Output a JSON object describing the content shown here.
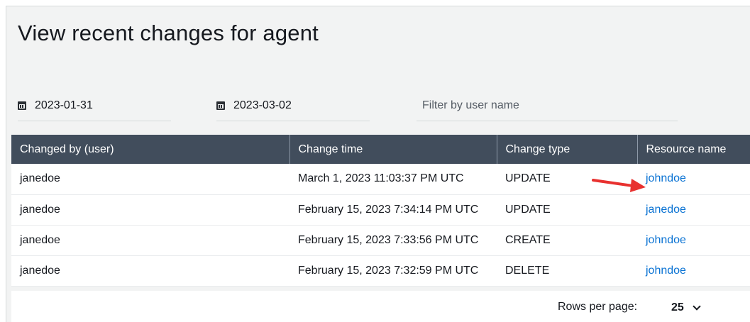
{
  "page": {
    "title": "View recent changes for agent"
  },
  "filters": {
    "start_date": "2023-01-31",
    "end_date": "2023-03-02",
    "user_placeholder": "Filter by user name",
    "user_value": ""
  },
  "table": {
    "columns": [
      "Changed by (user)",
      "Change time",
      "Change type",
      "Resource name"
    ],
    "rows": [
      [
        "janedoe",
        "March 1, 2023 11:03:37 PM UTC",
        "UPDATE",
        "johndoe"
      ],
      [
        "janedoe",
        "February 15, 2023 7:34:14 PM UTC",
        "UPDATE",
        "janedoe"
      ],
      [
        "janedoe",
        "February 15, 2023 7:33:56 PM UTC",
        "CREATE",
        "johndoe"
      ],
      [
        "janedoe",
        "February 15, 2023 7:32:59 PM UTC",
        "DELETE",
        "johndoe"
      ]
    ]
  },
  "pagination": {
    "rows_per_page_label": "Rows per page:",
    "rows_per_page_value": "25"
  },
  "annotation": {
    "icon": "red-arrow-icon",
    "color": "#e8312f"
  },
  "colors": {
    "header_bg": "#414d5c",
    "link": "#0972d3",
    "panel_bg": "#f2f3f3"
  }
}
